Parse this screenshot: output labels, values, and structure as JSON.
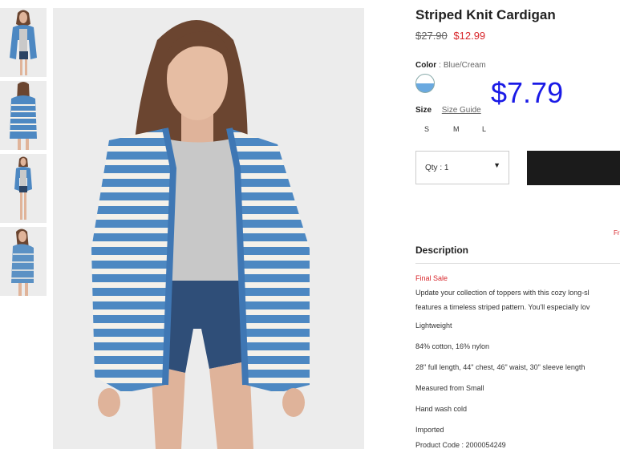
{
  "product": {
    "title": "Striped Knit Cardigan",
    "original_price": "$27.90",
    "sale_price": "$12.99",
    "overlay_price": "$7.79"
  },
  "color": {
    "label": "Color",
    "separator": ":",
    "value": "Blue/Cream",
    "swatch_colors": [
      "#ffffff",
      "#6aa9e0"
    ]
  },
  "size": {
    "label": "Size",
    "guide_label": "Size Guide",
    "options": [
      "S",
      "M",
      "L"
    ]
  },
  "quantity": {
    "text": "Qty : 1",
    "caret": "▼"
  },
  "cart": {
    "partial_text": "Fr"
  },
  "description": {
    "heading": "Description",
    "final_sale": "Final Sale",
    "lines": [
      "Update your collection of toppers with this cozy long-sl",
      "features a timeless striped pattern. You'll especially lov",
      "Lightweight",
      "84% cotton, 16% nylon",
      "28\" full length, 44\" chest, 46\" waist, 30\" sleeve length",
      "Measured from Small",
      "Hand wash cold",
      "Imported",
      "Product Code : 2000054249"
    ]
  },
  "images": {
    "thumb_names": [
      "front-view",
      "back-view",
      "full-view",
      "side-view"
    ],
    "main_name": "model-front"
  },
  "colors": {
    "sale": "#d8262b",
    "button": "#1b1b1b",
    "overlay_price": "#1a1ae6",
    "cardigan_blue": "#4d88c2"
  }
}
